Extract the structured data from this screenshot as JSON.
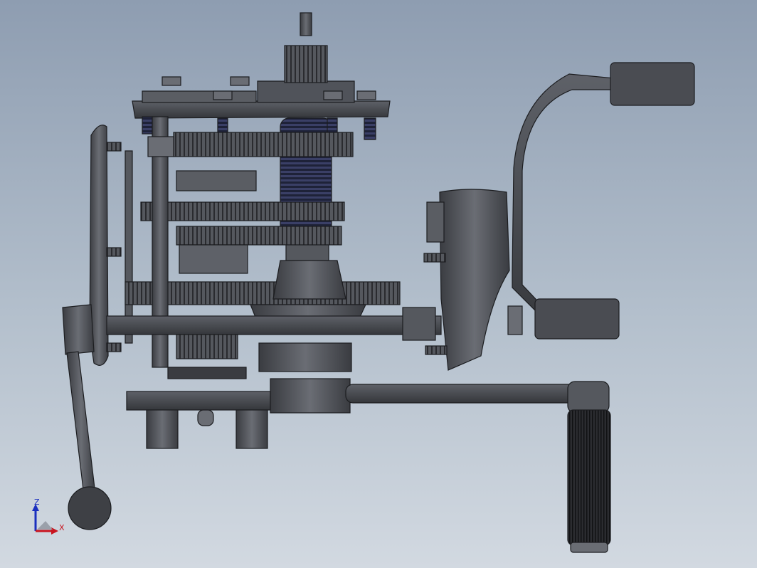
{
  "viewport": {
    "background_top": "#8e9db1",
    "background_bottom": "#d2d9e1"
  },
  "model": {
    "part_color": "#4a4c52",
    "edge_color": "#1c1d20",
    "highlight_color": "#6d7078"
  },
  "triad": {
    "z_label": "Z",
    "x_label": "X",
    "z_color": "#1a2fbf",
    "x_color": "#c8141e",
    "y_color": "#2a9a2a"
  }
}
